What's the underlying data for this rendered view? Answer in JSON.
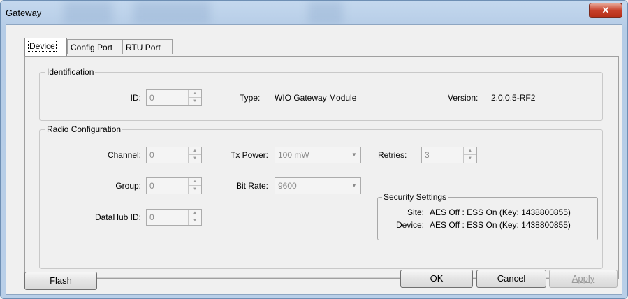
{
  "window": {
    "title": "Gateway",
    "close_label": "✕"
  },
  "tabs": [
    {
      "label": "Device"
    },
    {
      "label": "Config Port"
    },
    {
      "label": "RTU Port"
    }
  ],
  "identification": {
    "group_label": "Identification",
    "id_label": "ID:",
    "id_value": "0",
    "type_label": "Type:",
    "type_value": "WIO Gateway Module",
    "version_label": "Version:",
    "version_value": "2.0.0.5-RF2"
  },
  "radio": {
    "group_label": "Radio Configuration",
    "channel_label": "Channel:",
    "channel_value": "0",
    "group_field_label": "Group:",
    "group_value": "0",
    "datahub_label": "DataHub ID:",
    "datahub_value": "0",
    "txpower_label": "Tx Power:",
    "txpower_value": "100 mW",
    "bitrate_label": "Bit Rate:",
    "bitrate_value": "9600",
    "retries_label": "Retries:",
    "retries_value": "3"
  },
  "security": {
    "group_label": "Security Settings",
    "site_label": "Site:",
    "site_value": "AES Off : ESS On (Key: 1438800855)",
    "device_label": "Device:",
    "device_value": "AES Off : ESS On (Key: 1438800855)"
  },
  "buttons": {
    "flash": "Flash",
    "ok": "OK",
    "cancel": "Cancel",
    "apply": "Apply"
  }
}
